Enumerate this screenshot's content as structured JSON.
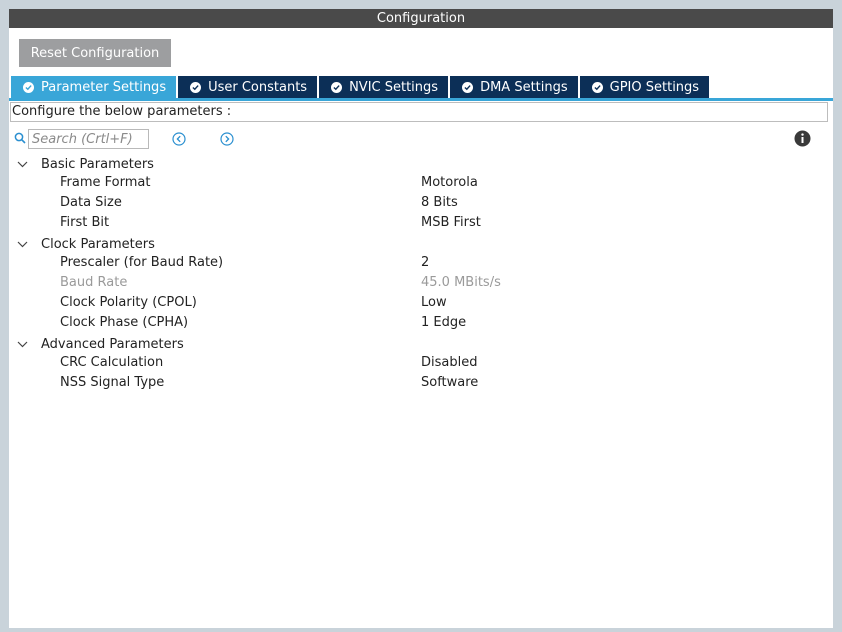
{
  "window": {
    "title": "Configuration"
  },
  "toolbar": {
    "reset_label": "Reset Configuration"
  },
  "tabs": [
    {
      "label": "Parameter Settings"
    },
    {
      "label": "User Constants"
    },
    {
      "label": "NVIC Settings"
    },
    {
      "label": "DMA Settings"
    },
    {
      "label": "GPIO Settings"
    }
  ],
  "configure_text": "Configure the below parameters :",
  "search": {
    "placeholder": "Search (Crtl+F)"
  },
  "groups": [
    {
      "label": "Basic Parameters",
      "params": [
        {
          "name": "Frame Format",
          "value": "Motorola"
        },
        {
          "name": "Data Size",
          "value": "8 Bits"
        },
        {
          "name": "First Bit",
          "value": "MSB First"
        }
      ]
    },
    {
      "label": "Clock Parameters",
      "params": [
        {
          "name": "Prescaler (for Baud Rate)",
          "value": "2"
        },
        {
          "name": "Baud Rate",
          "value": "45.0 MBits/s"
        },
        {
          "name": "Clock Polarity (CPOL)",
          "value": "Low"
        },
        {
          "name": "Clock Phase (CPHA)",
          "value": "1 Edge"
        }
      ]
    },
    {
      "label": "Advanced Parameters",
      "params": [
        {
          "name": "CRC Calculation",
          "value": "Disabled"
        },
        {
          "name": "NSS Signal Type",
          "value": "Software"
        }
      ]
    }
  ],
  "colors": {
    "active_tab": "#39a6d8",
    "tab": "#0c2f57",
    "titlebar": "#4a4a4a",
    "button": "#9d9ea0"
  },
  "icons": {
    "search": "search-icon",
    "prev": "chevron-left-circle-icon",
    "next": "chevron-right-circle-icon",
    "info": "info-icon",
    "tab_check": "check-circle-icon",
    "expand": "chevron-down-icon"
  }
}
